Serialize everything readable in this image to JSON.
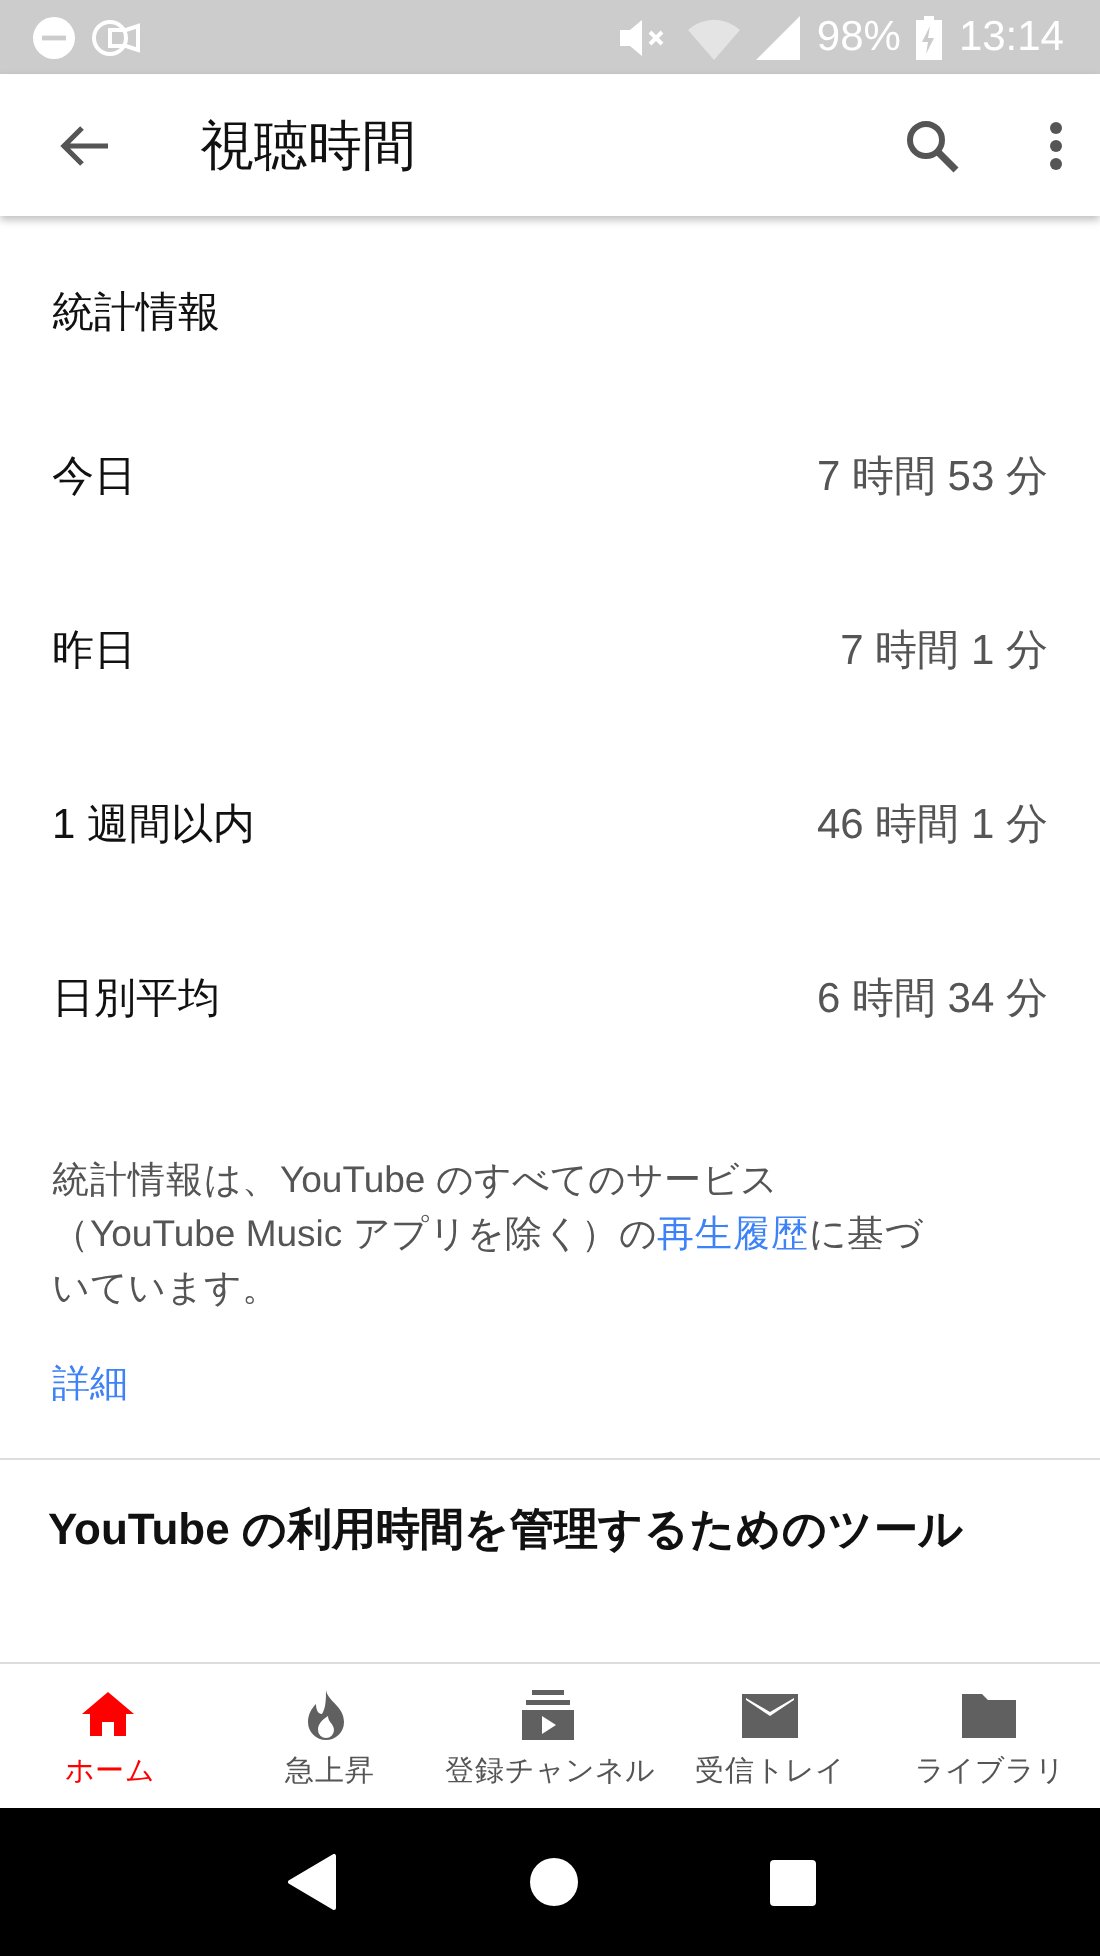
{
  "status_bar": {
    "battery": "98%",
    "time": "13:14"
  },
  "app_bar": {
    "title": "視聴時間"
  },
  "stats": {
    "heading": "統計情報",
    "rows": [
      {
        "label": "今日",
        "value": "7 時間 53 分"
      },
      {
        "label": "昨日",
        "value": "7 時間 1 分"
      },
      {
        "label": "1 週間以内",
        "value": "46 時間 1 分"
      },
      {
        "label": "日別平均",
        "value": "6 時間 34 分"
      }
    ]
  },
  "note": {
    "before": "統計情報は、YouTube のすべてのサービス（YouTube Music アプリを除く）の",
    "link": "再生履歴",
    "after": "に基づいています。",
    "more_link": "詳細"
  },
  "tools_heading": "YouTube の利用時間を管理するためのツール",
  "nav": {
    "items": [
      {
        "kind": "home",
        "label": "ホーム",
        "selected": true
      },
      {
        "kind": "flame",
        "label": "急上昇",
        "selected": false
      },
      {
        "kind": "subscriptions",
        "label": "登録チャンネル",
        "selected": false
      },
      {
        "kind": "mail",
        "label": "受信トレイ",
        "selected": false
      },
      {
        "kind": "folder",
        "label": "ライブラリ",
        "selected": false
      }
    ]
  }
}
